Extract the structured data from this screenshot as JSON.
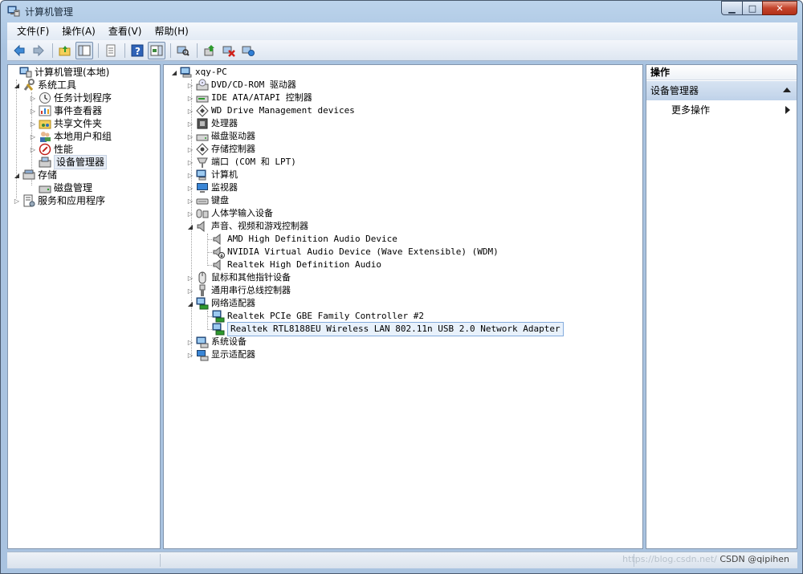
{
  "window": {
    "title": "计算机管理",
    "min_label": "▁",
    "max_label": "□",
    "close_label": "✕"
  },
  "menu": [
    {
      "label": "文件(F)"
    },
    {
      "label": "操作(A)"
    },
    {
      "label": "查看(V)"
    },
    {
      "label": "帮助(H)"
    }
  ],
  "toolbar": {
    "icons": [
      "back-icon",
      "forward-icon",
      "up-folder-icon",
      "show-tree-icon",
      "properties-icon",
      "help-icon",
      "show-action-pane-icon",
      "scan-hardware-icon",
      "update-driver-icon",
      "uninstall-icon",
      "enable-icon"
    ]
  },
  "left_tree": [
    {
      "label": "计算机管理(本地)"
    },
    {
      "label": "系统工具"
    },
    {
      "label": "任务计划程序"
    },
    {
      "label": "事件查看器"
    },
    {
      "label": "共享文件夹"
    },
    {
      "label": "本地用户和组"
    },
    {
      "label": "性能"
    },
    {
      "label": "设备管理器"
    },
    {
      "label": "存储"
    },
    {
      "label": "磁盘管理"
    },
    {
      "label": "服务和应用程序"
    }
  ],
  "device_tree": [
    {
      "label": "xqy-PC"
    },
    {
      "label": "DVD/CD-ROM 驱动器"
    },
    {
      "label": "IDE ATA/ATAPI 控制器"
    },
    {
      "label": "WD Drive Management devices"
    },
    {
      "label": "处理器"
    },
    {
      "label": "磁盘驱动器"
    },
    {
      "label": "存储控制器"
    },
    {
      "label": "端口 (COM 和 LPT)"
    },
    {
      "label": "计算机"
    },
    {
      "label": "监视器"
    },
    {
      "label": "键盘"
    },
    {
      "label": "人体学输入设备"
    },
    {
      "label": "声音、视频和游戏控制器"
    },
    {
      "label": "AMD High Definition Audio Device"
    },
    {
      "label": "NVIDIA Virtual Audio Device (Wave Extensible) (WDM)"
    },
    {
      "label": "Realtek High Definition Audio"
    },
    {
      "label": "鼠标和其他指针设备"
    },
    {
      "label": "通用串行总线控制器"
    },
    {
      "label": "网络适配器"
    },
    {
      "label": "Realtek PCIe GBE Family Controller #2"
    },
    {
      "label": "Realtek RTL8188EU Wireless LAN 802.11n USB 2.0 Network Adapter"
    },
    {
      "label": "系统设备"
    },
    {
      "label": "显示适配器"
    }
  ],
  "actions": {
    "header": "操作",
    "group": "设备管理器",
    "more": "更多操作"
  },
  "statusbar": {
    "watermark_url": "https://blog.csdn.net/",
    "watermark_author": "CSDN @qipihen"
  }
}
